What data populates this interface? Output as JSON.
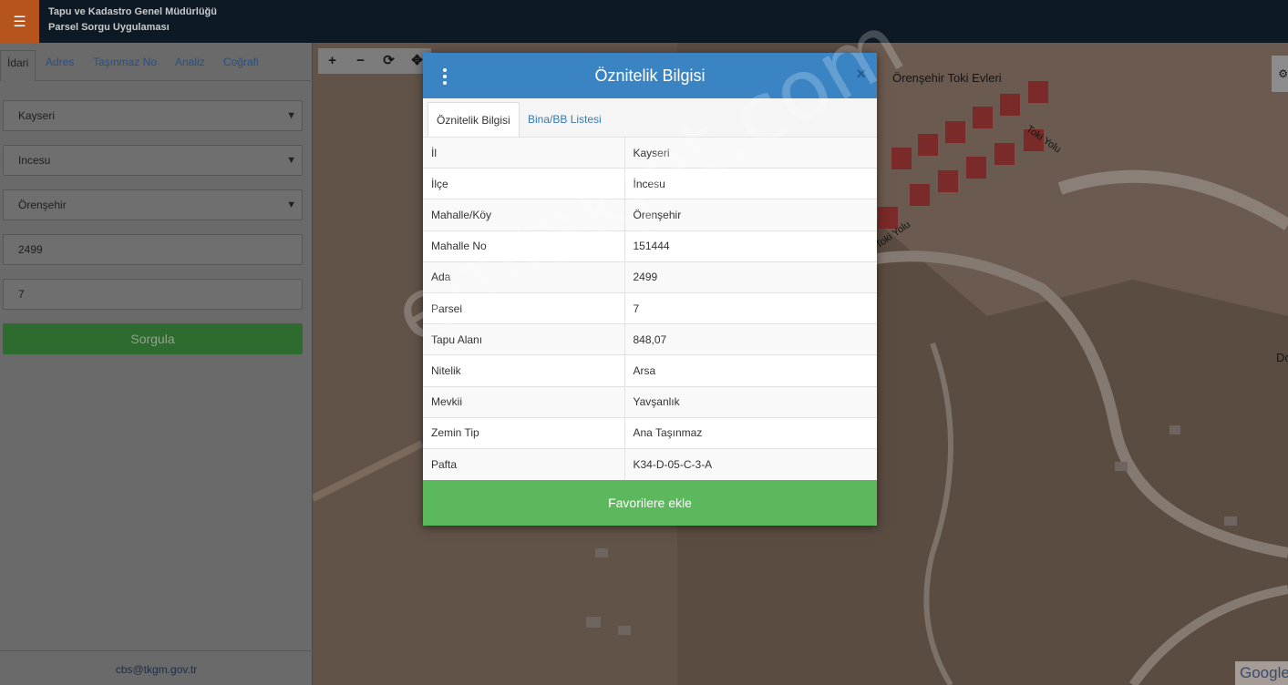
{
  "header": {
    "title_line1": "Tapu ve Kadastro Genel Müdürlüğü",
    "title_line2": "Parsel Sorgu Uygulaması",
    "menu_icon": "hamburger-icon"
  },
  "sidebar": {
    "tabs": [
      "İdari",
      "Adres",
      "Taşınmaz No",
      "Analiz",
      "Coğrafi"
    ],
    "active_tab": "İdari",
    "il": "Kayseri",
    "ilce": "Incesu",
    "mahalle": "Örenşehir",
    "ada": "2499",
    "parsel": "7",
    "query_button": "Sorgula",
    "footer_email": "cbs@tkgm.gov.tr"
  },
  "map": {
    "toolbar": [
      "+",
      "−",
      "⟳",
      "✥"
    ],
    "labels": {
      "poi": "Örenşehir Toki Evleri",
      "road1": "Toki Yolu",
      "road2": "Toki Yolu",
      "edge": "Do"
    },
    "attribution": "Google"
  },
  "dialog": {
    "title": "Öznitelik Bilgisi",
    "close": "×",
    "tabs": [
      "Öznitelik Bilgisi",
      "Bina/BB Listesi"
    ],
    "rows": [
      {
        "label": "İl",
        "value": "Kayseri"
      },
      {
        "label": "İlçe",
        "value": "İncesu"
      },
      {
        "label": "Mahalle/Köy",
        "value": "Örenşehir"
      },
      {
        "label": "Mahalle No",
        "value": "151444"
      },
      {
        "label": "Ada",
        "value": "2499"
      },
      {
        "label": "Parsel",
        "value": "7"
      },
      {
        "label": "Tapu Alanı",
        "value": "848,07"
      },
      {
        "label": "Nitelik",
        "value": "Arsa"
      },
      {
        "label": "Mevkii",
        "value": "Yavşanlık"
      },
      {
        "label": "Zemin Tip",
        "value": "Ana Taşınmaz"
      },
      {
        "label": "Pafta",
        "value": "K34-D-05-C-3-A"
      }
    ],
    "favorite_button": "Favorilere ekle"
  },
  "watermark": "emlakjet.com"
}
